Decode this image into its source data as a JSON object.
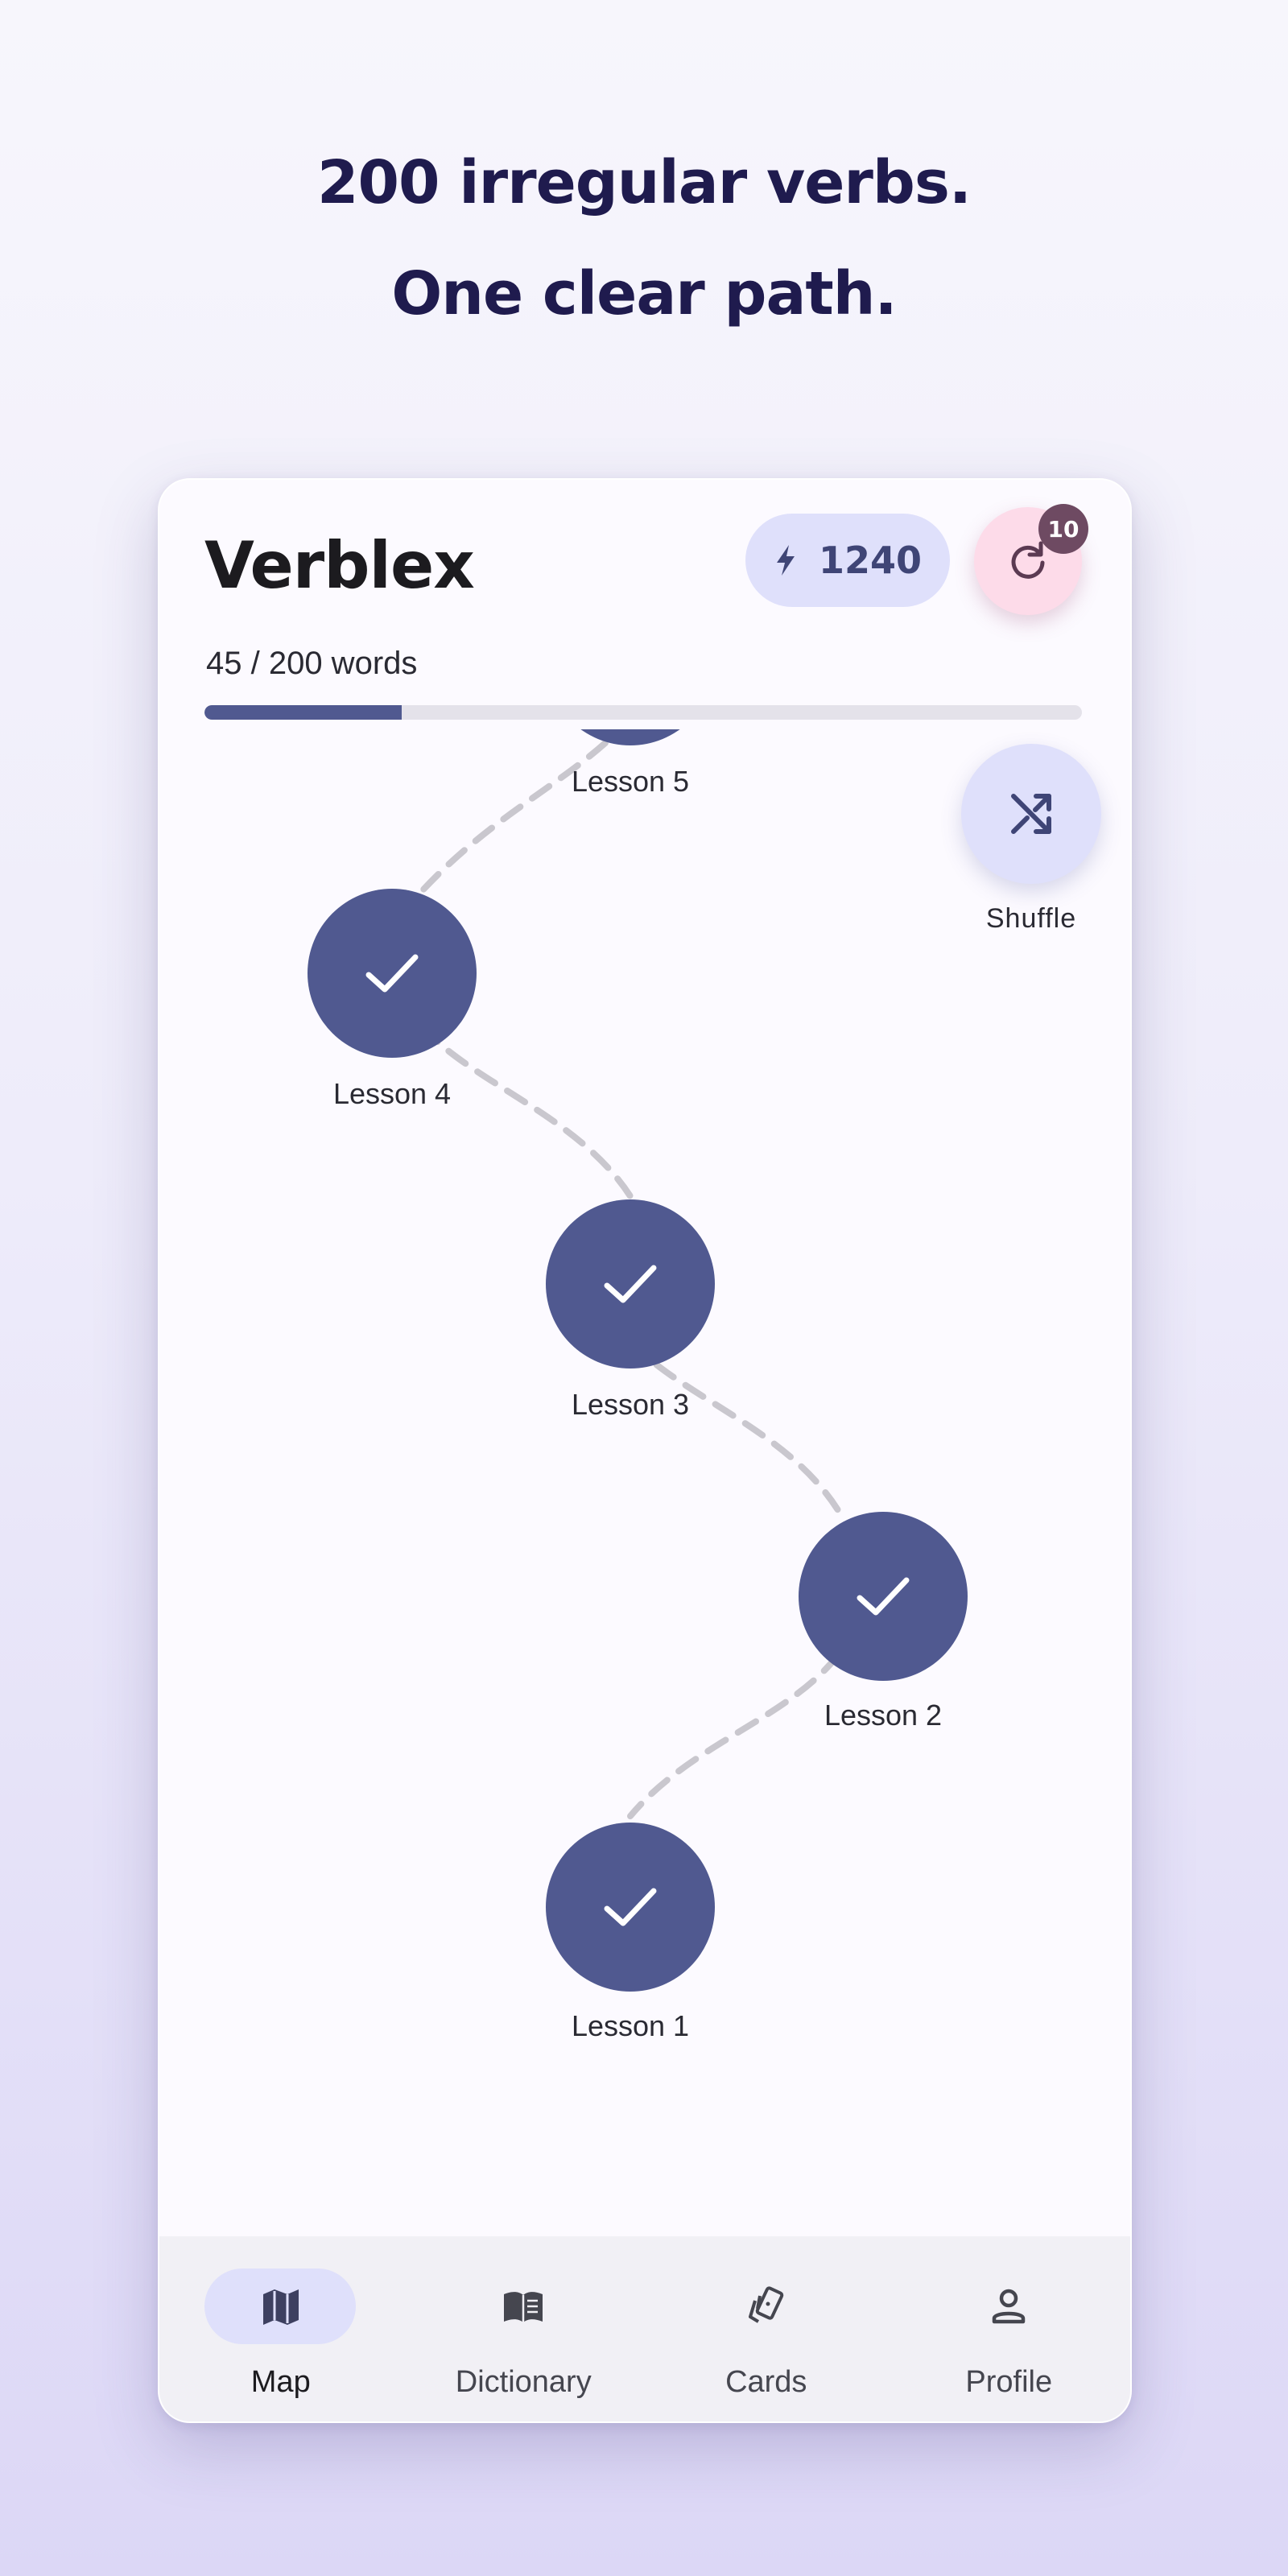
{
  "headline": {
    "line1": "200 irregular verbs.",
    "line2": "One clear path."
  },
  "app": {
    "title": "Verblex",
    "xp": "1240",
    "refresh_badge": "10",
    "progress_label": "45 / 200 words",
    "progress_fraction": 0.225,
    "shuffle_label": "Shuffle"
  },
  "lessons": [
    {
      "label": "Lesson 5",
      "completed": true
    },
    {
      "label": "Lesson 4",
      "completed": true
    },
    {
      "label": "Lesson 3",
      "completed": true
    },
    {
      "label": "Lesson 2",
      "completed": true
    },
    {
      "label": "Lesson 1",
      "completed": true
    }
  ],
  "nav": {
    "items": [
      {
        "label": "Map",
        "icon": "map-icon",
        "active": true
      },
      {
        "label": "Dictionary",
        "icon": "book-icon",
        "active": false
      },
      {
        "label": "Cards",
        "icon": "cards-icon",
        "active": false
      },
      {
        "label": "Profile",
        "icon": "person-icon",
        "active": false
      }
    ]
  },
  "colors": {
    "primary": "#505990",
    "primary_container": "#dfe0fb",
    "tertiary_container": "#fddbe9",
    "badge": "#6e4a62",
    "headline": "#1f1b4e"
  }
}
